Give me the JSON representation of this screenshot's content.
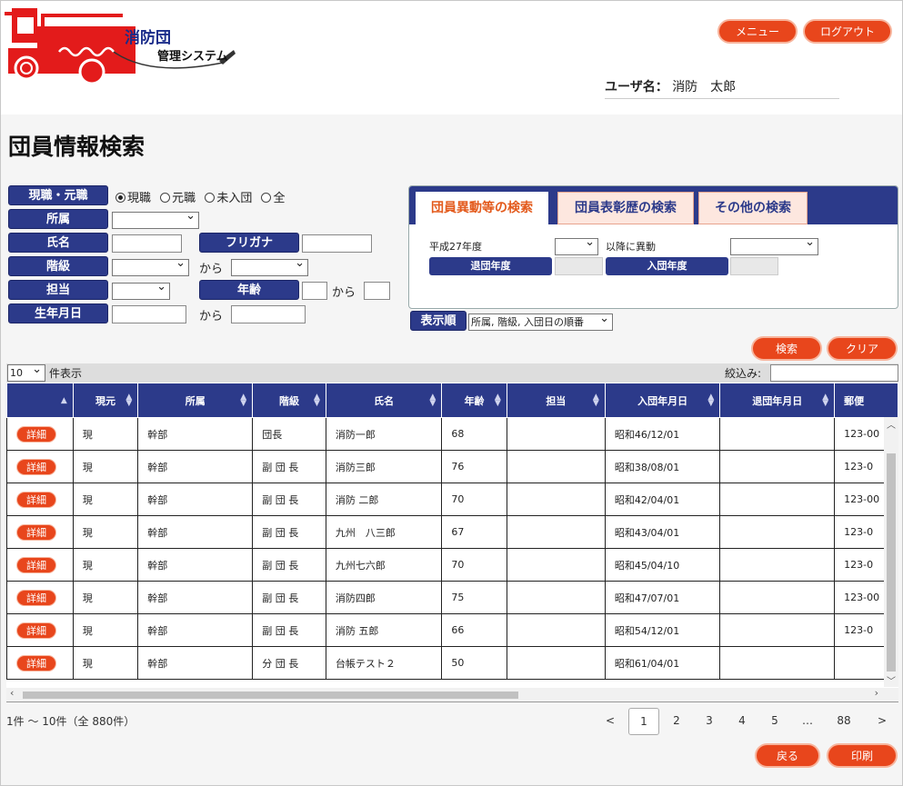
{
  "app": {
    "logo_line1": "消防団",
    "logo_line2": "管理システム"
  },
  "header": {
    "menu_label": "メニュー",
    "logout_label": "ログアウト",
    "user_label": "ユーザ名：",
    "user_name": "消防　太郎"
  },
  "page_title": "団員情報検索",
  "form": {
    "status_label": "現職・元職",
    "status_options": [
      "現職",
      "元職",
      "未入団",
      "全"
    ],
    "status_selected": "現職",
    "affiliation_label": "所属",
    "name_label": "氏名",
    "kana_label": "フリガナ",
    "rank_label": "階級",
    "from_text": "から",
    "charge_label": "担当",
    "age_label": "年齢",
    "birth_label": "生年月日"
  },
  "tabs": {
    "items": [
      "団員異動等の検索",
      "団員表彰歴の検索",
      "その他の検索"
    ],
    "active": 0,
    "year_text": "平成27年度",
    "after_text": "以降に異動",
    "retire_year_label": "退団年度",
    "join_year_label": "入団年度"
  },
  "order": {
    "label": "表示順",
    "value": "所属, 階級, 入団日の順番"
  },
  "actions": {
    "search_label": "検索",
    "clear_label": "クリア",
    "back_label": "戻る",
    "print_label": "印刷"
  },
  "table_controls": {
    "page_size": "10",
    "page_size_suffix": "件表示",
    "filter_label": "絞込み:"
  },
  "table": {
    "columns": [
      "",
      "現元",
      "所属",
      "階級",
      "氏名",
      "年齢",
      "担当",
      "入団年月日",
      "退団年月日",
      "郵便"
    ],
    "detail_label": "詳細",
    "rows": [
      [
        "現",
        "幹部",
        "団長",
        "消防一郎",
        "68",
        "",
        "昭和46/12/01",
        "",
        "123-00"
      ],
      [
        "現",
        "幹部",
        "副 団 長",
        "消防三郎",
        "76",
        "",
        "昭和38/08/01",
        "",
        "123-0"
      ],
      [
        "現",
        "幹部",
        "副 団 長",
        "消防 二郎",
        "70",
        "",
        "昭和42/04/01",
        "",
        "123-00"
      ],
      [
        "現",
        "幹部",
        "副 団 長",
        "九州　八三郎",
        "67",
        "",
        "昭和43/04/01",
        "",
        "123-0"
      ],
      [
        "現",
        "幹部",
        "副 団 長",
        "九州七六郎",
        "70",
        "",
        "昭和45/04/10",
        "",
        "123-0"
      ],
      [
        "現",
        "幹部",
        "副 団 長",
        "消防四郎",
        "75",
        "",
        "昭和47/07/01",
        "",
        "123-00"
      ],
      [
        "現",
        "幹部",
        "副 団 長",
        "消防 五郎",
        "66",
        "",
        "昭和54/12/01",
        "",
        "123-0"
      ],
      [
        "現",
        "幹部",
        "分 団 長",
        "台帳テスト２",
        "50",
        "",
        "昭和61/04/01",
        "",
        ""
      ]
    ]
  },
  "pagination": {
    "summary": "1件 ～ 10件（全 880件）",
    "prev": "<",
    "pages": [
      "1",
      "2",
      "3",
      "4",
      "5",
      "…",
      "88"
    ],
    "current": "1",
    "next": ">"
  },
  "colors": {
    "brand_navy": "#2c3a8a",
    "accent_orange": "#e8461c"
  }
}
